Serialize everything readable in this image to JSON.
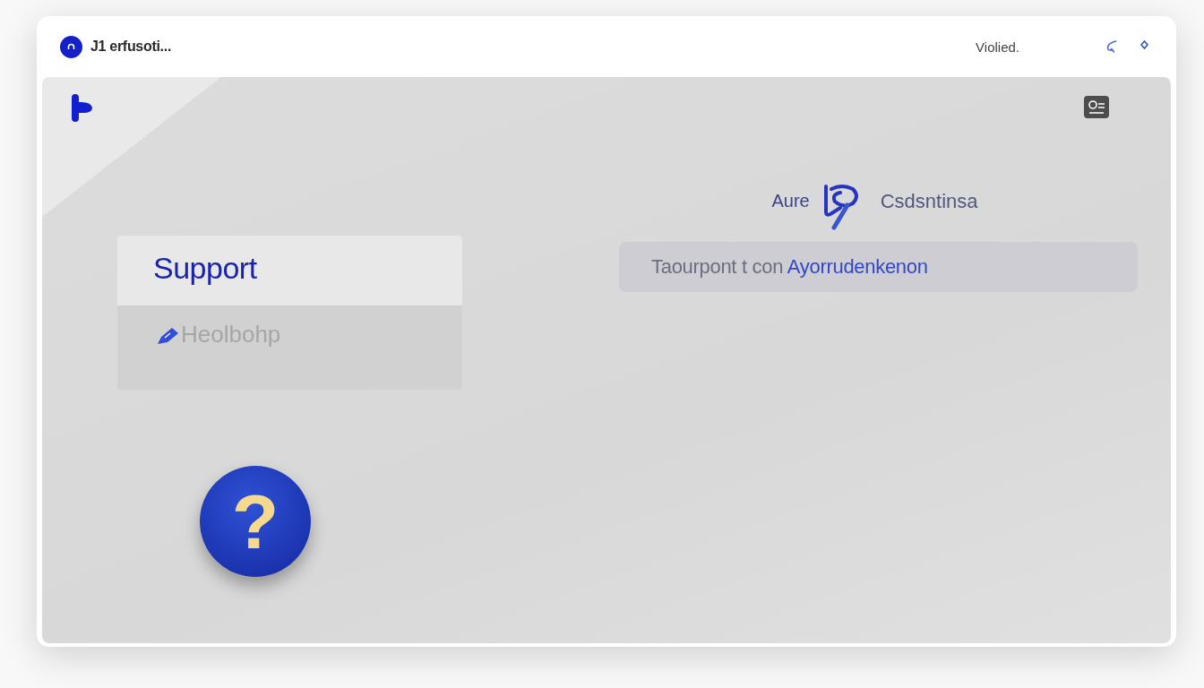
{
  "header": {
    "title": "J1 erfusoti...",
    "status": "Violied."
  },
  "menu": {
    "items": [
      {
        "label": "Support",
        "kind": "title",
        "selected": true
      },
      {
        "label": "Heolbohp",
        "kind": "link",
        "selected": false
      }
    ]
  },
  "help_button": {
    "label": "?"
  },
  "heading": {
    "left": "Aure",
    "right": "Csdsntinsa"
  },
  "banner": {
    "text": "Taourpont t con",
    "link": "Ayorrudenkenon"
  }
}
